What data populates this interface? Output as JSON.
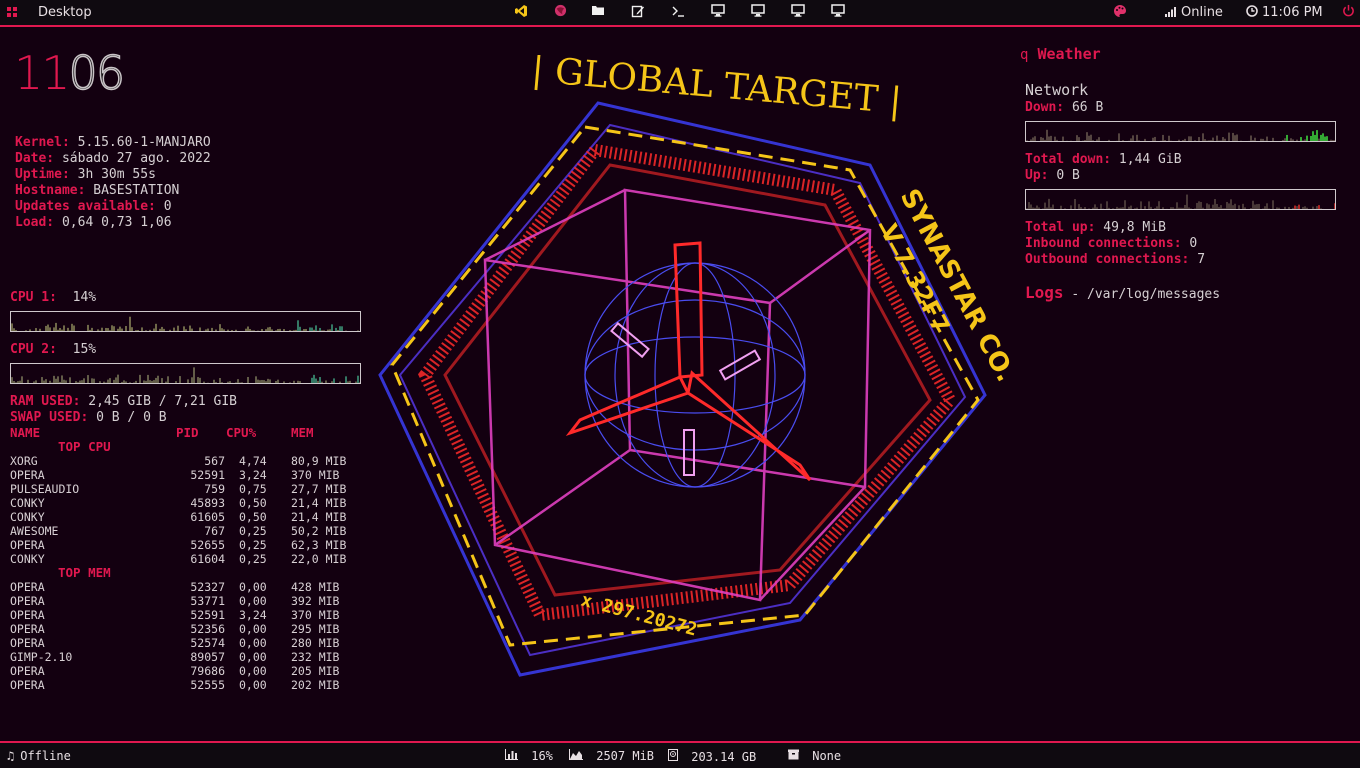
{
  "topbar": {
    "desktop_label": "Desktop",
    "launchers": [
      "vscode-icon",
      "browser-icon",
      "folder-icon",
      "text-editor-icon",
      "terminal-icon",
      "monitor-1-icon",
      "monitor-2-icon",
      "monitor-3-icon",
      "monitor-4-icon"
    ],
    "network_status": "Online",
    "time": "11:06 PM"
  },
  "clock": {
    "hours": "11",
    "minutes": "06"
  },
  "sysinfo": [
    {
      "key": "Kernel:",
      "value": "5.15.60-1-MANJARO"
    },
    {
      "key": "Date:",
      "value": "sábado  27 ago. 2022"
    },
    {
      "key": "Uptime:",
      "value": "3h 30m 55s"
    },
    {
      "key": "Hostname:",
      "value": "BASESTATION"
    },
    {
      "key": "Updates available:",
      "value": "0"
    },
    {
      "key": "Load:",
      "value": "0,64 0,73 1,06"
    }
  ],
  "cpu": [
    {
      "label": "CPU 1:",
      "value": "14%"
    },
    {
      "label": "CPU 2:",
      "value": "15%"
    }
  ],
  "memory": {
    "ram_label": "RAM USED:",
    "ram_value": "2,45 GIB / 7,21 GIB",
    "swap_label": "SWAP USED:",
    "swap_value": "0 B / 0 B"
  },
  "processes": {
    "headers": [
      "NAME",
      "PID",
      "CPU%",
      "MEM"
    ],
    "top_cpu_title": "TOP CPU",
    "top_cpu": [
      [
        "XORG",
        "567",
        "4,74",
        "80,9 MIB"
      ],
      [
        "OPERA",
        "52591",
        "3,24",
        "370 MIB"
      ],
      [
        "PULSEAUDIO",
        "759",
        "0,75",
        "27,7 MIB"
      ],
      [
        "CONKY",
        "45893",
        "0,50",
        "21,4 MIB"
      ],
      [
        "CONKY",
        "61605",
        "0,50",
        "21,4 MIB"
      ],
      [
        "AWESOME",
        "767",
        "0,25",
        "50,2 MIB"
      ],
      [
        "OPERA",
        "52655",
        "0,25",
        "62,3 MIB"
      ],
      [
        "CONKY",
        "61604",
        "0,25",
        "22,0 MIB"
      ]
    ],
    "top_mem_title": "TOP MEM",
    "top_mem": [
      [
        "OPERA",
        "52327",
        "0,00",
        "428 MIB"
      ],
      [
        "OPERA",
        "53771",
        "0,00",
        "392 MIB"
      ],
      [
        "OPERA",
        "52591",
        "3,24",
        "370 MIB"
      ],
      [
        "OPERA",
        "52356",
        "0,00",
        "295 MIB"
      ],
      [
        "OPERA",
        "52574",
        "0,00",
        "280 MIB"
      ],
      [
        "GIMP-2.10",
        "89057",
        "0,00",
        "232 MIB"
      ],
      [
        "OPERA",
        "79686",
        "0,00",
        "205 MIB"
      ],
      [
        "OPERA",
        "52555",
        "0,00",
        "202 MIB"
      ]
    ]
  },
  "weather": {
    "icon": "q",
    "title": "Weather"
  },
  "network": {
    "title": "Network",
    "down_label": "Down:",
    "down_value": "66 B",
    "total_down_label": "Total down:",
    "total_down_value": "1,44 GiB",
    "up_label": "Up:",
    "up_value": "0 B",
    "total_up_label": "Total up:",
    "total_up_value": "49,8 MiB",
    "inbound_label": "Inbound connections:",
    "inbound_value": "0",
    "outbound_label": "Outbound connections:",
    "outbound_value": "7"
  },
  "logs": {
    "title": "Logs",
    "path": "- /var/log/messages"
  },
  "wallpaper": {
    "title": "| GLOBAL TARGET |",
    "side_text": "SYNASTAR CO.",
    "version": "V 7.32F7",
    "bottom_text": "x 297.20272"
  },
  "bottombar": {
    "offline": "Offline",
    "cpu": "16%",
    "mem": "2507 MiB",
    "disk": "203.14 GB",
    "updates": "None"
  },
  "colors": {
    "accent": "#e0184f",
    "bg": "#130010",
    "yellow": "#f5c518",
    "blue": "#3a3ae8",
    "magenta": "#e040c0"
  }
}
